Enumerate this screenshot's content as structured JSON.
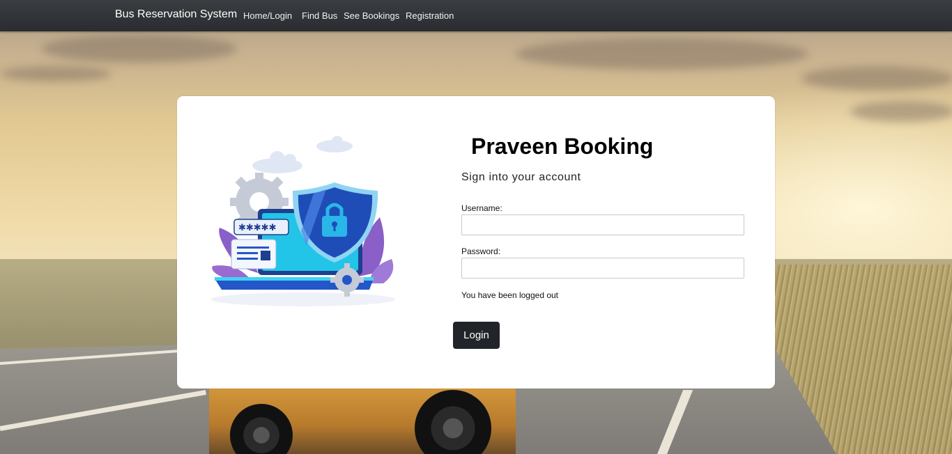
{
  "navbar": {
    "brand": "Bus Reservation System",
    "links": [
      "Home/Login",
      "Find Bus",
      "See Bookings",
      "Registration"
    ]
  },
  "card": {
    "title": "Praveen Booking",
    "subtitle": "Sign into your account",
    "username_label": "Username:",
    "username_value": "",
    "password_label": "Password:",
    "password_value": "",
    "status_message": "You have been logged out",
    "login_label": "Login"
  },
  "colors": {
    "navbar": "#2f3236",
    "button": "#212529",
    "card": "#ffffff"
  },
  "icons": [
    "security-laptop-illustration",
    "shield-lock-icon",
    "gear-icon",
    "cloud-icon"
  ]
}
